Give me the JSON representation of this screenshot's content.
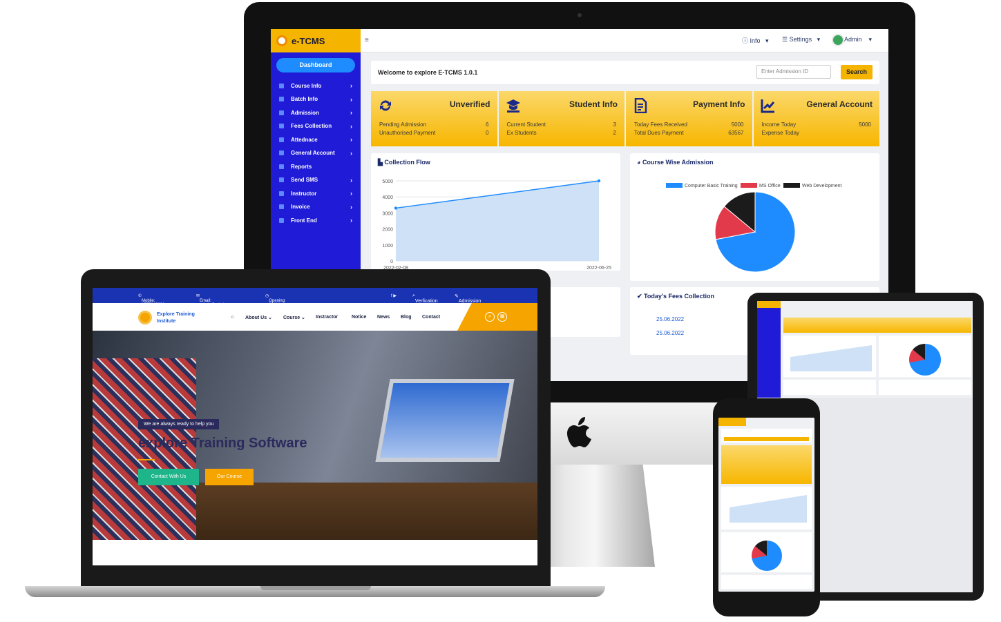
{
  "etcms": {
    "brand": "e-TCMS",
    "topbar": {
      "info": "Info",
      "settings": "Settings",
      "admin": "Admin"
    },
    "sidebar": {
      "dashboard": "Dashboard",
      "items": [
        {
          "label": "Course Info",
          "chevron": true
        },
        {
          "label": "Batch Info",
          "chevron": true
        },
        {
          "label": "Admission",
          "chevron": true
        },
        {
          "label": "Fees Collection",
          "chevron": true
        },
        {
          "label": "Attednace",
          "chevron": true
        },
        {
          "label": "General Account",
          "chevron": true
        },
        {
          "label": "Reports",
          "chevron": false
        },
        {
          "label": "Send SMS",
          "chevron": true
        },
        {
          "label": "Instructor",
          "chevron": true
        },
        {
          "label": "Invoice",
          "chevron": true
        },
        {
          "label": "Front End",
          "chevron": true
        }
      ]
    },
    "welcome": "Welcome to explore E-TCMS 1.0.1",
    "search": {
      "placeholder": "Enter Admission ID",
      "button": "Search"
    },
    "cards": [
      {
        "title": "Unverified",
        "icon": "refresh-icon",
        "rows": [
          [
            "Pending Admission",
            "6"
          ],
          [
            "Unauthorised Payment",
            "0"
          ]
        ]
      },
      {
        "title": "Student Info",
        "icon": "graduate-icon",
        "rows": [
          [
            "Current Student",
            "3"
          ],
          [
            "Ex Students",
            "2"
          ]
        ]
      },
      {
        "title": "Payment Info",
        "icon": "document-icon",
        "rows": [
          [
            "Today Fees Received",
            "5000"
          ],
          [
            "Total Dues Payment",
            "63567"
          ]
        ]
      },
      {
        "title": "General Account",
        "icon": "chart-line-icon",
        "rows": [
          [
            "Income Today",
            "5000"
          ],
          [
            "Expense Today",
            ""
          ]
        ]
      }
    ],
    "collection_flow": {
      "title": "Collection Flow",
      "y_ticks": [
        "5000",
        "4000",
        "3000",
        "2000",
        "1000",
        "0"
      ],
      "x_labels": [
        "2022-02-08",
        "2022-06-25"
      ]
    },
    "course_wise": {
      "title": "Course Wise Admission",
      "legend": [
        "Computer Basic Training",
        "MS Office",
        "Web Development"
      ]
    },
    "fees_today": {
      "title": "Today's Fees Collection",
      "dates": [
        "25.06.2022",
        "25.06.2022"
      ]
    }
  },
  "chart_data": [
    {
      "type": "area",
      "title": "Collection Flow",
      "x": [
        "2022-02-08",
        "2022-06-25"
      ],
      "values": [
        3300,
        5000
      ],
      "ylim": [
        0,
        5000
      ],
      "grid": true,
      "color": "#1e8cff"
    },
    {
      "type": "pie",
      "title": "Course Wise Admission",
      "categories": [
        "Computer Basic Training",
        "MS Office",
        "Web Development"
      ],
      "values": [
        72,
        14,
        14
      ],
      "colors": [
        "#1e8cff",
        "#e23a4a",
        "#1b1b1b"
      ],
      "legend": "top"
    }
  ],
  "website": {
    "topbar": {
      "mobile": "Mobile: 1777615690",
      "email": "Email: admin@admin.com",
      "opening": "Opening: 09AM - 05PM",
      "verification": "Verfication",
      "admission": "Admission"
    },
    "brand_line1": "Explore Training",
    "brand_line2": "Institute",
    "nav": [
      "About Us ⌄",
      "Course ⌄",
      "Instractor",
      "Notice",
      "News",
      "Blog",
      "Contact"
    ],
    "hero": {
      "tag": "We are always ready to help you",
      "title": "explore Training Software",
      "btn_contact": "Contact With Us",
      "btn_course": "Our Course"
    }
  },
  "colors": {
    "accent_yellow": "#f5b400",
    "sidebar_blue": "#1f1bd6",
    "primary_blue": "#1e8cff",
    "site_blue": "#1a33b3",
    "orange": "#f5a400",
    "green": "#1fb58a"
  }
}
